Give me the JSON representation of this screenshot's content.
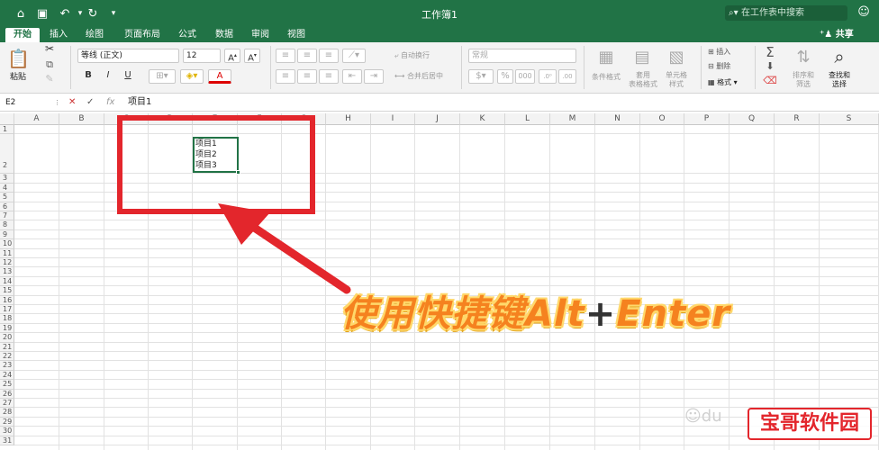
{
  "window": {
    "title": "工作簿1",
    "search_placeholder": "在工作表中搜索"
  },
  "tabs": [
    "开始",
    "插入",
    "绘图",
    "页面布局",
    "公式",
    "数据",
    "审阅",
    "视图"
  ],
  "active_tab": "开始",
  "share_label": "共享",
  "ribbon": {
    "paste_label": "粘贴",
    "font_name": "等线 (正文)",
    "font_size": "12",
    "bold": "B",
    "italic": "I",
    "underline": "U",
    "wrap_text": "自动换行",
    "merge_center": "合并后居中",
    "number_format": "常规",
    "percent": "%",
    "thousands": "000",
    "conditional_format": "条件格式",
    "table_format": "套用\n表格格式",
    "cell_style": "单元格\n样式",
    "insert": "插入",
    "delete": "删除",
    "format": "格式",
    "sort_filter": "排序和\n筛选",
    "find_select": "查找和\n选择"
  },
  "formula_bar": {
    "name_box": "E2",
    "fx": "fx",
    "content": "项目1"
  },
  "columns": [
    "A",
    "B",
    "C",
    "D",
    "E",
    "F",
    "G",
    "H",
    "I",
    "J",
    "K",
    "L",
    "M",
    "N",
    "O",
    "P",
    "Q",
    "R",
    "S"
  ],
  "rows": [
    "1",
    "2",
    "3",
    "4",
    "5",
    "6",
    "7",
    "8",
    "9",
    "10",
    "11",
    "12",
    "13",
    "14",
    "15",
    "16",
    "17",
    "18",
    "19",
    "20",
    "21",
    "22",
    "23",
    "24",
    "25",
    "26",
    "27",
    "28",
    "29",
    "30",
    "31"
  ],
  "cell_e2": [
    "项目1",
    "项目2",
    "项目3"
  ],
  "annotation": {
    "prefix": "使用快捷键",
    "alt": "Alt",
    "plus": "+",
    "enter": "Enter"
  },
  "watermark": "宝哥软件园",
  "colors": {
    "accent": "#217346",
    "annotation_red": "#e3262c",
    "caption_orange": "#f5821f"
  }
}
